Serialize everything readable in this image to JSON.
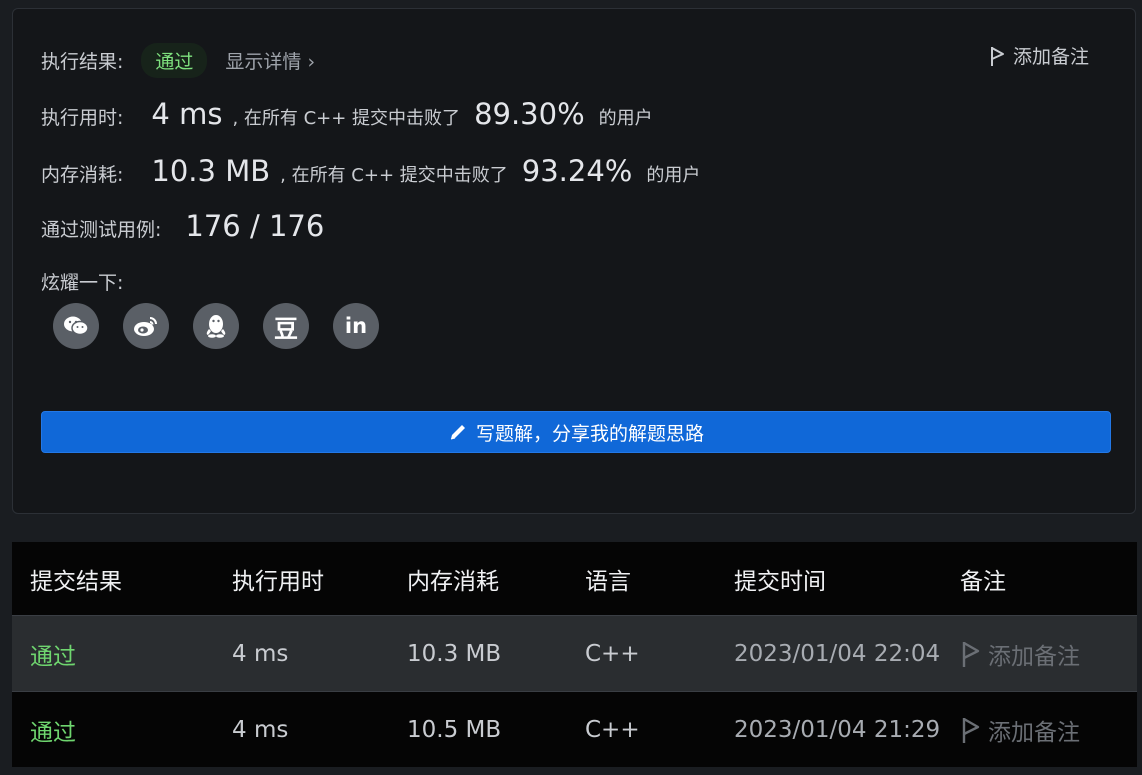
{
  "summary": {
    "result_label": "执行结果:",
    "result_badge": "通过",
    "details_link": "显示详情 ›",
    "add_note": "添加备注",
    "time_label": "执行用时:",
    "time_value": "4 ms",
    "time_text": ", 在所有 C++ 提交中击败了",
    "time_percent": "89.30%",
    "users_text": "的用户",
    "memory_label": "内存消耗:",
    "memory_value": "10.3 MB",
    "memory_text": ", 在所有 C++ 提交中击败了",
    "memory_percent": "93.24%",
    "memory_users_text": "的用户",
    "tests_label": "通过测试用例:",
    "tests_value": "176 / 176",
    "share_label": "炫耀一下:",
    "share_icons": [
      "wechat-icon",
      "weibo-icon",
      "qq-icon",
      "douban-icon",
      "linkedin-icon"
    ],
    "douban_glyph": "豆",
    "linkedin_glyph": "in",
    "cta_label": "写题解，分享我的解题思路"
  },
  "table": {
    "headers": [
      "提交结果",
      "执行用时",
      "内存消耗",
      "语言",
      "提交时间",
      "备注"
    ],
    "rows": [
      {
        "result": "通过",
        "time": "4 ms",
        "memory": "10.3 MB",
        "lang": "C++",
        "submitted": "2023/01/04 22:04",
        "note": "添加备注"
      },
      {
        "result": "通过",
        "time": "4 ms",
        "memory": "10.5 MB",
        "lang": "C++",
        "submitted": "2023/01/04 21:29",
        "note": "添加备注"
      }
    ]
  },
  "colors": {
    "accent": "#1068d8",
    "success": "#6fd66f",
    "background": "#1a1d21"
  }
}
